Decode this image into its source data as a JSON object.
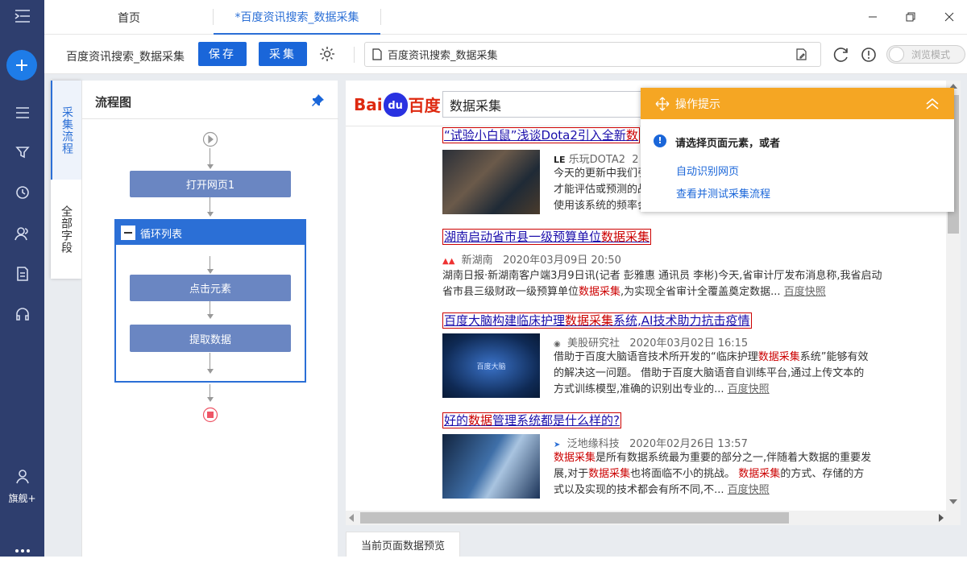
{
  "sidebar": {
    "flagship_label": "旗舰+"
  },
  "tabs": {
    "home": "首页",
    "active": "*百度资讯搜索_数据采集"
  },
  "toolbar": {
    "task_name": "百度资讯搜索_数据采集",
    "save_label": "保存",
    "collect_label": "采集",
    "url": "百度资讯搜索_数据采集",
    "browse_mode": "浏览模式"
  },
  "side_tabs": {
    "flow": "采集流程",
    "fields": "全部字段"
  },
  "flow": {
    "title": "流程图",
    "open_page": "打开网页1",
    "loop_list": "循环列表",
    "click_element": "点击元素",
    "extract_data": "提取数据"
  },
  "browser": {
    "logo_bai": "Bai",
    "logo_du": "du",
    "logo_baidu": "百度",
    "search_query": "数据采集",
    "results": [
      {
        "title_pre": "“试验小白鼠”浅谈Dota2引入全新",
        "title_red": "数",
        "title_post": "",
        "source": "乐玩DOTA2",
        "date": "2",
        "line1": "今天的更新中我们引",
        "line2": "才能评估或预测的战",
        "line3": "使用该系统的频率会"
      },
      {
        "title_pre": "湖南启动省市县一级预算单位",
        "title_red": "数据采集",
        "title_post": "",
        "source": "新湖南",
        "date": "2020年03月09日 20:50",
        "line1": "湖南日报·新湖南客户端3月9日讯(记者 彭雅惠 通讯员 李彬)今天,省审计厅发布消息称,我省启动",
        "line2_pre": "省市县三级财政一级预算单位",
        "line2_red": "数据采集",
        "line2_post": ",为实现全省审计全覆盖奠定数据... ",
        "snapshot": "百度快照"
      },
      {
        "title_pre": "百度大脑构建临床护理",
        "title_red": "数据采集",
        "title_post": "系统,AI技术助力抗击疫情",
        "source": "美股研究社",
        "date": "2020年03月02日 16:15",
        "line1_pre": "借助于百度大脑语音技术所开发的“临床护理",
        "line1_red": "数据采集",
        "line1_post": "系统”能够有效",
        "line2": "的解决这一问题。 借助于百度大脑语音自训练平台,通过上传文本的",
        "line3": "方式训练模型,准确的识别出专业的... ",
        "snapshot": "百度快照",
        "thumb_text": "百度大脑"
      },
      {
        "title_pre": "好的",
        "title_red": "数据",
        "title_post": "管理系统都是什么样的?",
        "source": "泛地缘科技",
        "date": "2020年02月26日 13:57",
        "line1_red": "数据采集",
        "line1_post": "是所有数据系统最为重要的部分之一,伴随着大数据的重要发",
        "line2_pre": "展,对于",
        "line2_red": "数据采集",
        "line2_mid": "也将面临不小的挑战。 ",
        "line2_red2": "数据采集",
        "line2_post": "的方式、存储的方",
        "line3": "式以及实现的技术都会有所不同,不... ",
        "snapshot": "百度快照"
      }
    ]
  },
  "tip": {
    "title": "操作提示",
    "message": "请选择页面元素，或者",
    "link1": "自动识别网页",
    "link2": "查看并测试采集流程"
  },
  "preview": {
    "tab": "当前页面数据预览"
  }
}
